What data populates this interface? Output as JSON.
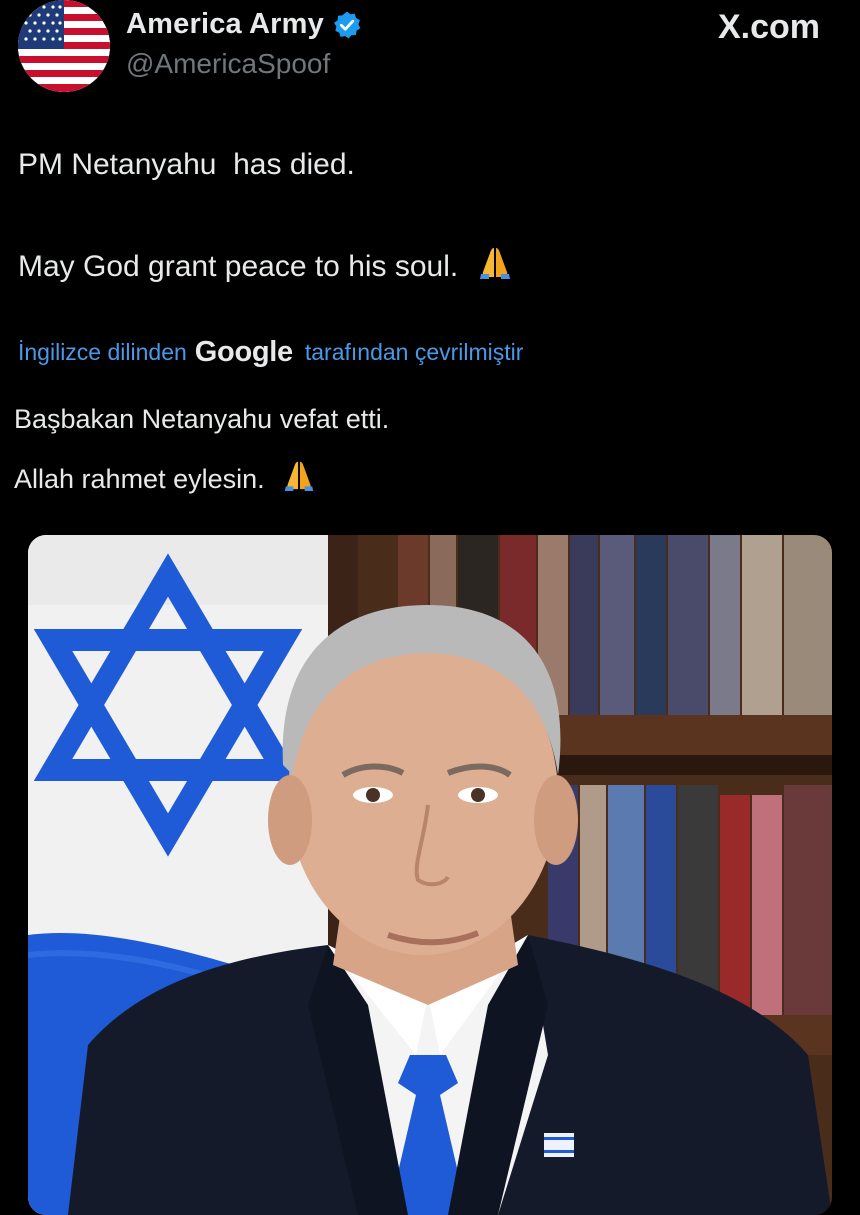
{
  "header": {
    "display_name": "America Army",
    "handle": "@AmericaSpoof",
    "site": "X.com",
    "avatar_icon": "us-flag-icon",
    "verified_icon": "verified-badge-icon",
    "verified_color": "#1d9bf0"
  },
  "tweet": {
    "line1": "PM Netanyahu  has died.",
    "line2": "May God grant peace to his soul.",
    "emoji_icon": "folded-hands-emoji"
  },
  "translation": {
    "prefix": "İngilizce dilinden",
    "provider": "Google",
    "suffix": "tarafından çevrilmiştir",
    "line1": "Başbakan Netanyahu vefat etti.",
    "line2": "Allah rahmet eylesin."
  },
  "media": {
    "description_icon": "photo-portrait-with-flag"
  },
  "colors": {
    "background": "#000000",
    "text": "#e7e9ea",
    "secondary": "#71767b",
    "link": "#4a99e9",
    "flag_blue": "#1f5bd6"
  }
}
